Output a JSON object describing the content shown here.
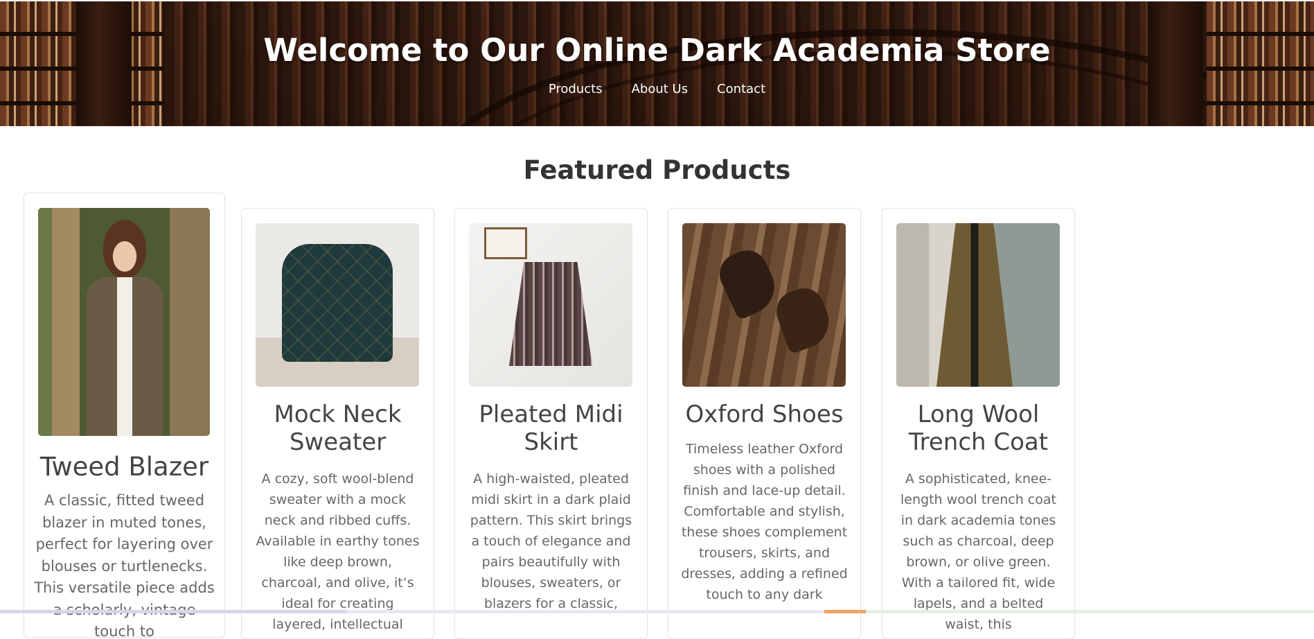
{
  "header": {
    "title": "Welcome to Our Online Dark Academia Store",
    "nav": [
      "Products",
      "About Us",
      "Contact"
    ]
  },
  "featured": {
    "title": "Featured Products",
    "products": [
      {
        "name": "Tweed Blazer",
        "description": "A classic, fitted tweed blazer in muted tones, perfect for layering over blouses or turtlenecks. This versatile piece adds a scholarly, vintage touch to"
      },
      {
        "name": "Mock Neck Sweater",
        "description": "A cozy, soft wool-blend sweater with a mock neck and ribbed cuffs. Available in earthy tones like deep brown, charcoal, and olive, it’s ideal for creating layered, intellectual looks."
      },
      {
        "name": "Pleated Midi Skirt",
        "description": "A high-waisted, pleated midi skirt in a dark plaid pattern. This skirt brings a touch of elegance and pairs beautifully with blouses, sweaters, or blazers for a classic,"
      },
      {
        "name": "Oxford Shoes",
        "description": "Timeless leather Oxford shoes with a polished finish and lace-up detail. Comfortable and stylish, these shoes complement trousers, skirts, and dresses, adding a refined touch to any dark"
      },
      {
        "name": "Long Wool Trench Coat",
        "description": "A sophisticated, knee-length wool trench coat in dark academia tones such as charcoal, deep brown, or olive green. With a tailored fit, wide lapels, and a belted waist, this"
      }
    ]
  }
}
